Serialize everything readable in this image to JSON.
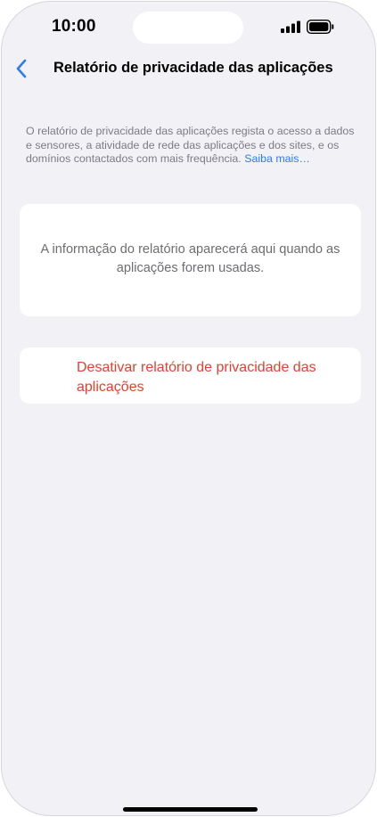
{
  "status_bar": {
    "time": "10:00",
    "signal_icon": "cellular-signal-icon",
    "battery_icon": "battery-icon"
  },
  "nav": {
    "back_icon": "chevron-left-icon",
    "title": "Relatório de privacidade das aplicações"
  },
  "description": {
    "text": "O relatório de privacidade das aplicações regista o acesso a dados e sensores, a atividade de rede das aplicações e dos sites, e os domínios contactados com mais frequência.",
    "link_label": "Saiba mais…"
  },
  "info_card": {
    "text": "A informação do relatório aparecerá aqui quando as aplicações forem usadas."
  },
  "disable_button": {
    "label": "Desativar relatório de privacidade das aplicações"
  },
  "colors": {
    "background": "#f1f1f6",
    "accent": "#2f7bf5",
    "destructive": "#e5402f"
  }
}
